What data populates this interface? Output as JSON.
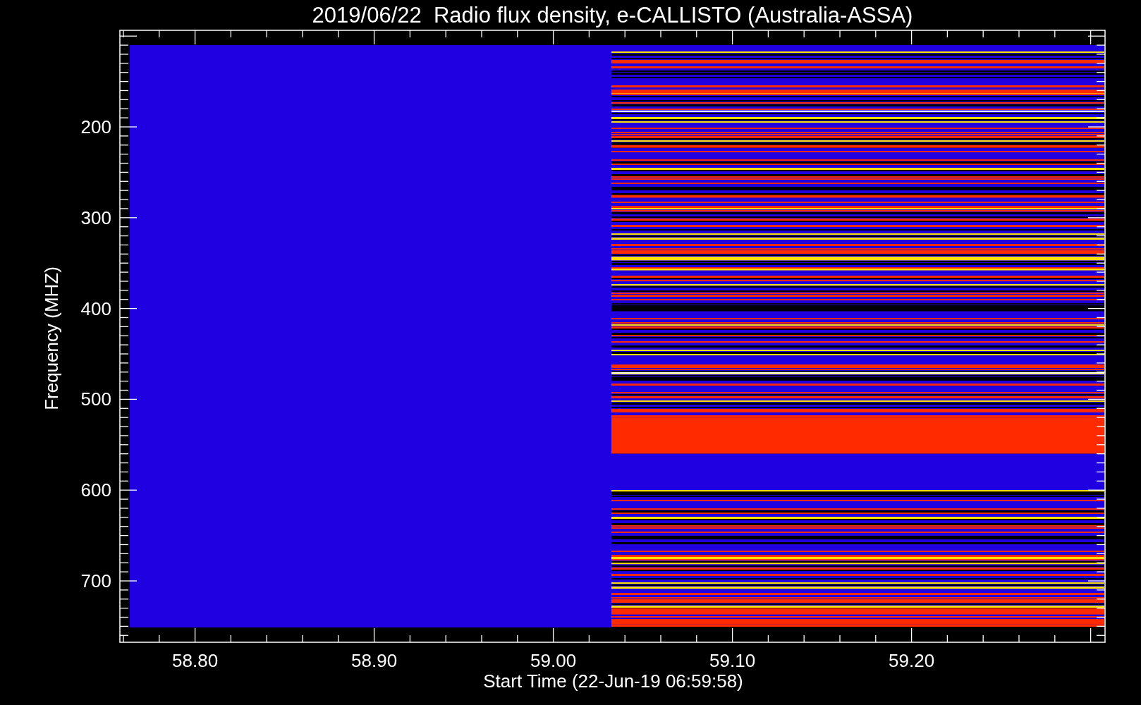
{
  "plot": {
    "title": "2019/06/22  Radio flux density, e-CALLISTO (Australia-ASSA)",
    "xlabel": "Start Time (22-Jun-19 06:59:58)",
    "ylabel": "Frequency (MHZ)",
    "x_tick_labels": [
      "58.80",
      "58.90",
      "59.00",
      "59.10",
      "59.20"
    ],
    "y_tick_labels": [
      "200",
      "300",
      "400",
      "500",
      "600",
      "700"
    ]
  }
}
